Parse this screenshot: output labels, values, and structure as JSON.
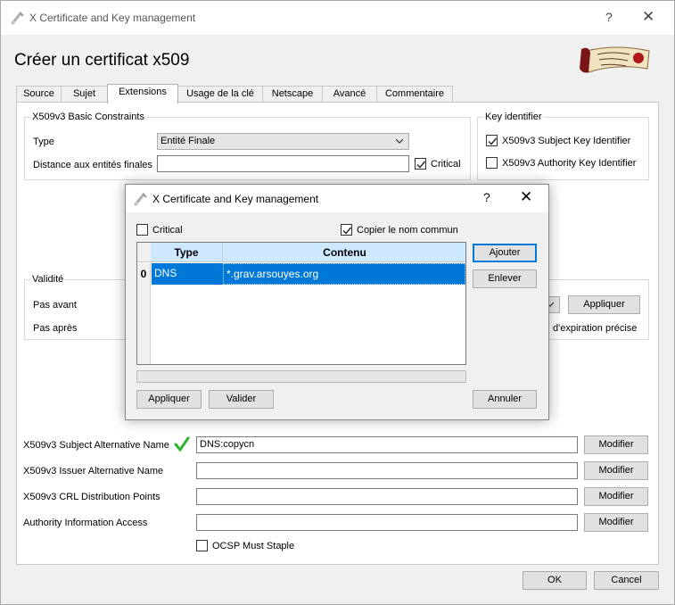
{
  "window": {
    "title": "X Certificate and Key management",
    "help": "?",
    "close": "✕",
    "heading": "Créer un certificat x509"
  },
  "tabs": [
    {
      "label": "Source",
      "active": false
    },
    {
      "label": "Sujet",
      "active": false
    },
    {
      "label": "Extensions",
      "active": true
    },
    {
      "label": "Usage de la clé",
      "active": false
    },
    {
      "label": "Netscape",
      "active": false
    },
    {
      "label": "Avancé",
      "active": false
    },
    {
      "label": "Commentaire",
      "active": false
    }
  ],
  "basic_constraints": {
    "title": "X509v3 Basic Constraints",
    "type_label": "Type",
    "type_value": "Entité Finale",
    "distance_label": "Distance aux entités finales",
    "distance_value": "",
    "critical_label": "Critical",
    "critical_checked": true
  },
  "key_identifier": {
    "title": "Key identifier",
    "subject_label": "X509v3 Subject Key Identifier",
    "subject_checked": true,
    "authority_label": "X509v3 Authority Key Identifier",
    "authority_checked": false
  },
  "validity": {
    "title": "Validité",
    "not_before_label": "Pas avant",
    "not_after_label": "Pas après",
    "apply_label": "Appliquer",
    "expiry_text": "d'expiration précise"
  },
  "alt_names": [
    {
      "label": "X509v3 Subject Alternative Name",
      "value": "DNS:copycn",
      "button": "Modifier",
      "valid": true
    },
    {
      "label": "X509v3 Issuer Alternative Name",
      "value": "",
      "button": "Modifier",
      "valid": false
    },
    {
      "label": "X509v3 CRL Distribution Points",
      "value": "",
      "button": "Modifier",
      "valid": false
    },
    {
      "label": "Authority Information Access",
      "value": "",
      "button": "Modifier",
      "valid": false
    }
  ],
  "ocsp": {
    "label": "OCSP Must Staple",
    "checked": false
  },
  "footer": {
    "ok": "OK",
    "cancel": "Cancel"
  },
  "dialog": {
    "title": "X Certificate and Key management",
    "help": "?",
    "close": "✕",
    "critical_label": "Critical",
    "critical_checked": false,
    "copy_cn_label": "Copier le nom commun",
    "copy_cn_checked": true,
    "columns": [
      "Type",
      "Contenu"
    ],
    "rows": [
      {
        "index": "0",
        "type": "DNS",
        "content": "*.grav.arsouyes.org"
      }
    ],
    "add_button": "Ajouter",
    "remove_button": "Enlever",
    "apply_button": "Appliquer",
    "validate_button": "Valider",
    "cancel_button": "Annuler"
  },
  "colors": {
    "selection": "#0078d7",
    "header": "#cde8ff",
    "check_green": "#2db52d",
    "focus": "#0078d7"
  }
}
